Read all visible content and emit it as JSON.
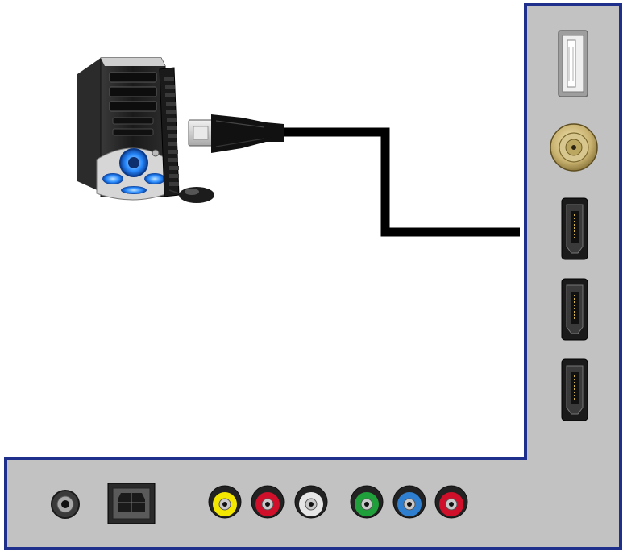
{
  "scene": {
    "description_visible_text": ""
  },
  "colors": {
    "panel_fill": "#c2c2c2",
    "panel_border": "#1f2f8c",
    "cable": "#000000",
    "background": "#ffffff",
    "rca_yellow": "#f3e600",
    "rca_red": "#d0102a",
    "rca_white": "#e6e6e6",
    "rca_green": "#1fa03a",
    "rca_blue": "#2f7fd0",
    "rca_red_2": "#d0102a",
    "pc_led_blue": "#2a8cff"
  },
  "icons": {
    "computer": "desktop-pc-icon",
    "keyboard": "keyboard-icon",
    "mouse": "mouse-icon",
    "hdmi_plug": "hdmi-plug-icon",
    "usb_port": "usb-port-icon",
    "coax_port": "coaxial-port-icon",
    "hdmi_port": "hdmi-port-icon",
    "audio_jack": "headphone-jack-icon",
    "optical_port": "optical-audio-port-icon",
    "rca_jack": "rca-jack-icon"
  },
  "ports": {
    "side": [
      "usb",
      "coax",
      "hdmi-1",
      "hdmi-2",
      "hdmi-3"
    ],
    "bottom": [
      "audio-out",
      "optical",
      "composite-video",
      "composite-audio-l",
      "composite-audio-r",
      "component-y",
      "component-pb",
      "component-pr"
    ]
  },
  "connection": {
    "from": "computer",
    "to": "hdmi-1"
  }
}
